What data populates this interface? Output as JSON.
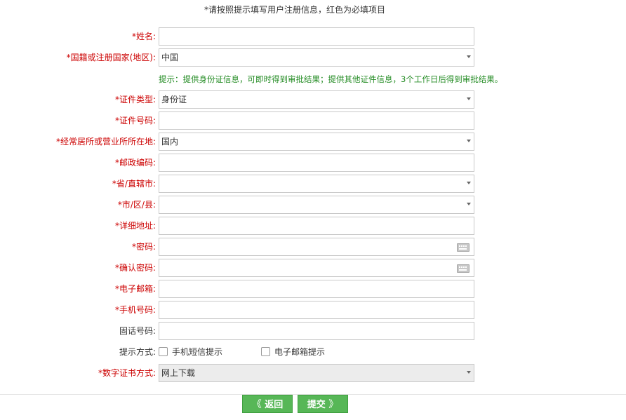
{
  "top_note": "*请按照提示填写用户注册信息，红色为必填项目",
  "fields": {
    "name": {
      "label": "*姓名:",
      "value": ""
    },
    "country": {
      "label": "*国籍或注册国家(地区):",
      "value": "中国"
    },
    "id_type": {
      "label": "*证件类型:",
      "value": "身份证"
    },
    "id_number": {
      "label": "*证件号码:",
      "value": ""
    },
    "residence": {
      "label": "*经常居所或营业所所在地:",
      "value": "国内"
    },
    "postcode": {
      "label": "*邮政编码:",
      "value": ""
    },
    "province": {
      "label": "*省/直辖市:",
      "value": ""
    },
    "city": {
      "label": "*市/区/县:",
      "value": ""
    },
    "address": {
      "label": "*详细地址:",
      "value": ""
    },
    "password": {
      "label": "*密码:",
      "value": ""
    },
    "confirm_password": {
      "label": "*确认密码:",
      "value": ""
    },
    "email": {
      "label": "*电子邮箱:",
      "value": ""
    },
    "mobile": {
      "label": "*手机号码:",
      "value": ""
    },
    "landline": {
      "label": "固话号码:",
      "value": ""
    },
    "notify": {
      "label": "提示方式:",
      "options": [
        "手机短信提示",
        "电子邮箱提示"
      ]
    },
    "cert_method": {
      "label": "*数字证书方式:",
      "value": "网上下载"
    }
  },
  "hint": "提示：提供身份证信息，可即时得到审批结果；提供其他证件信息，3个工作日后得到审批结果。",
  "buttons": {
    "back": "返回",
    "submit": "提交",
    "back_chevron": "《",
    "submit_chevron": "》"
  }
}
